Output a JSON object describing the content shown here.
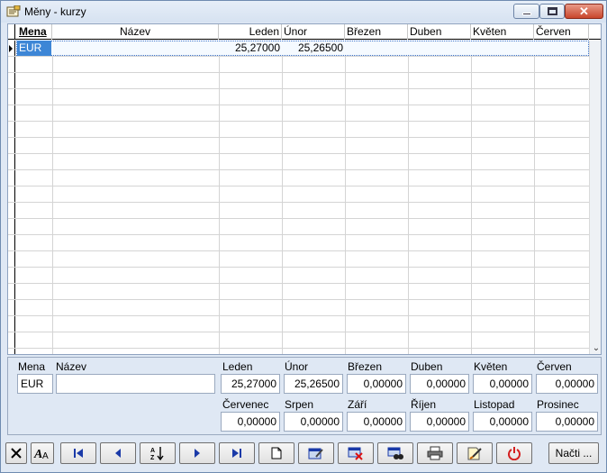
{
  "window": {
    "title": "Měny - kurzy"
  },
  "grid": {
    "columns": [
      "Mena",
      "Název",
      "Leden",
      "Únor",
      "Březen",
      "Duben",
      "Květen",
      "Červen"
    ],
    "rows": [
      {
        "code": "EUR",
        "name": "",
        "leden": "25,27000",
        "unor": "25,26500",
        "brezen": "",
        "duben": "",
        "kveten": "",
        "cerven": ""
      }
    ]
  },
  "detail": {
    "labels": {
      "mena": "Mena",
      "nazev": "Název",
      "leden": "Leden",
      "unor": "Únor",
      "brezen": "Březen",
      "duben": "Duben",
      "kveten": "Květen",
      "cerven": "Červen",
      "cervenec": "Červenec",
      "srpen": "Srpen",
      "zari": "Září",
      "rijen": "Říjen",
      "listopad": "Listopad",
      "prosinec": "Prosinec"
    },
    "values": {
      "mena": "EUR",
      "nazev": "",
      "leden": "25,27000",
      "unor": "25,26500",
      "brezen": "0,00000",
      "duben": "0,00000",
      "kveten": "0,00000",
      "cerven": "0,00000",
      "cervenec": "0,00000",
      "srpen": "0,00000",
      "zari": "0,00000",
      "rijen": "0,00000",
      "listopad": "0,00000",
      "prosinec": "0,00000"
    }
  },
  "toolbar": {
    "load_label": "Načti ..."
  },
  "colors": {
    "selection": "#3d86d6",
    "window_bg": "#dfe8f4",
    "close_red": "#c9462c"
  }
}
